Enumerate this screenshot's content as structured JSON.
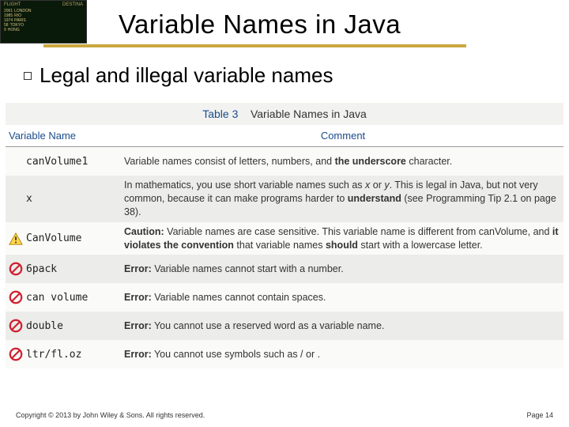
{
  "header": {
    "flight_board": {
      "head_left": "FLIGHT",
      "head_right": "DESTINA",
      "rows": [
        [
          "2061",
          "LONDON"
        ],
        [
          "1985",
          "RIO"
        ],
        [
          "1974",
          "PARIS"
        ],
        [
          "58",
          "TOKYO"
        ],
        [
          "9",
          "HONG"
        ]
      ]
    },
    "title": "Variable Names in Java"
  },
  "bullet": {
    "text": "Legal and illegal variable names"
  },
  "table": {
    "caption_num": "Table 3",
    "caption_title": "Variable Names in Java",
    "header_col1": "Variable Name",
    "header_col2": "Comment",
    "rows": [
      {
        "icon": "",
        "name": "canVolume1",
        "comment_html": "Variable names consist of letters, numbers, and <b>the underscore</b> character."
      },
      {
        "icon": "",
        "name": "x",
        "comment_html": "In mathematics, you use short variable names such as <i>x</i> or <i>y</i>. This is legal in Java, but not very common, because it can make programs harder to <b>understand</b> (see Programming Tip 2.1 on page 38)."
      },
      {
        "icon": "warn",
        "name": "CanVolume",
        "comment_html": "<b>Caution:</b> Variable names are case sensitive. This variable name is different from canVolume, and <b>it violates the convention</b> that variable names <b>should</b> start with a lowercase letter."
      },
      {
        "icon": "forbid",
        "name": "6pack",
        "comment_html": "<b>Error:</b> Variable names cannot start with a number."
      },
      {
        "icon": "forbid",
        "name": "can volume",
        "comment_html": "<b>Error:</b> Variable names cannot contain spaces."
      },
      {
        "icon": "forbid",
        "name": "double",
        "comment_html": "<b>Error:</b> You cannot use a reserved word as a variable name."
      },
      {
        "icon": "forbid",
        "name": "ltr/fl.oz",
        "comment_html": "<b>Error:</b> You cannot use symbols such as / or ."
      }
    ]
  },
  "footer": {
    "copyright": "Copyright © 2013 by John Wiley & Sons. All rights reserved.",
    "page": "Page 14"
  }
}
